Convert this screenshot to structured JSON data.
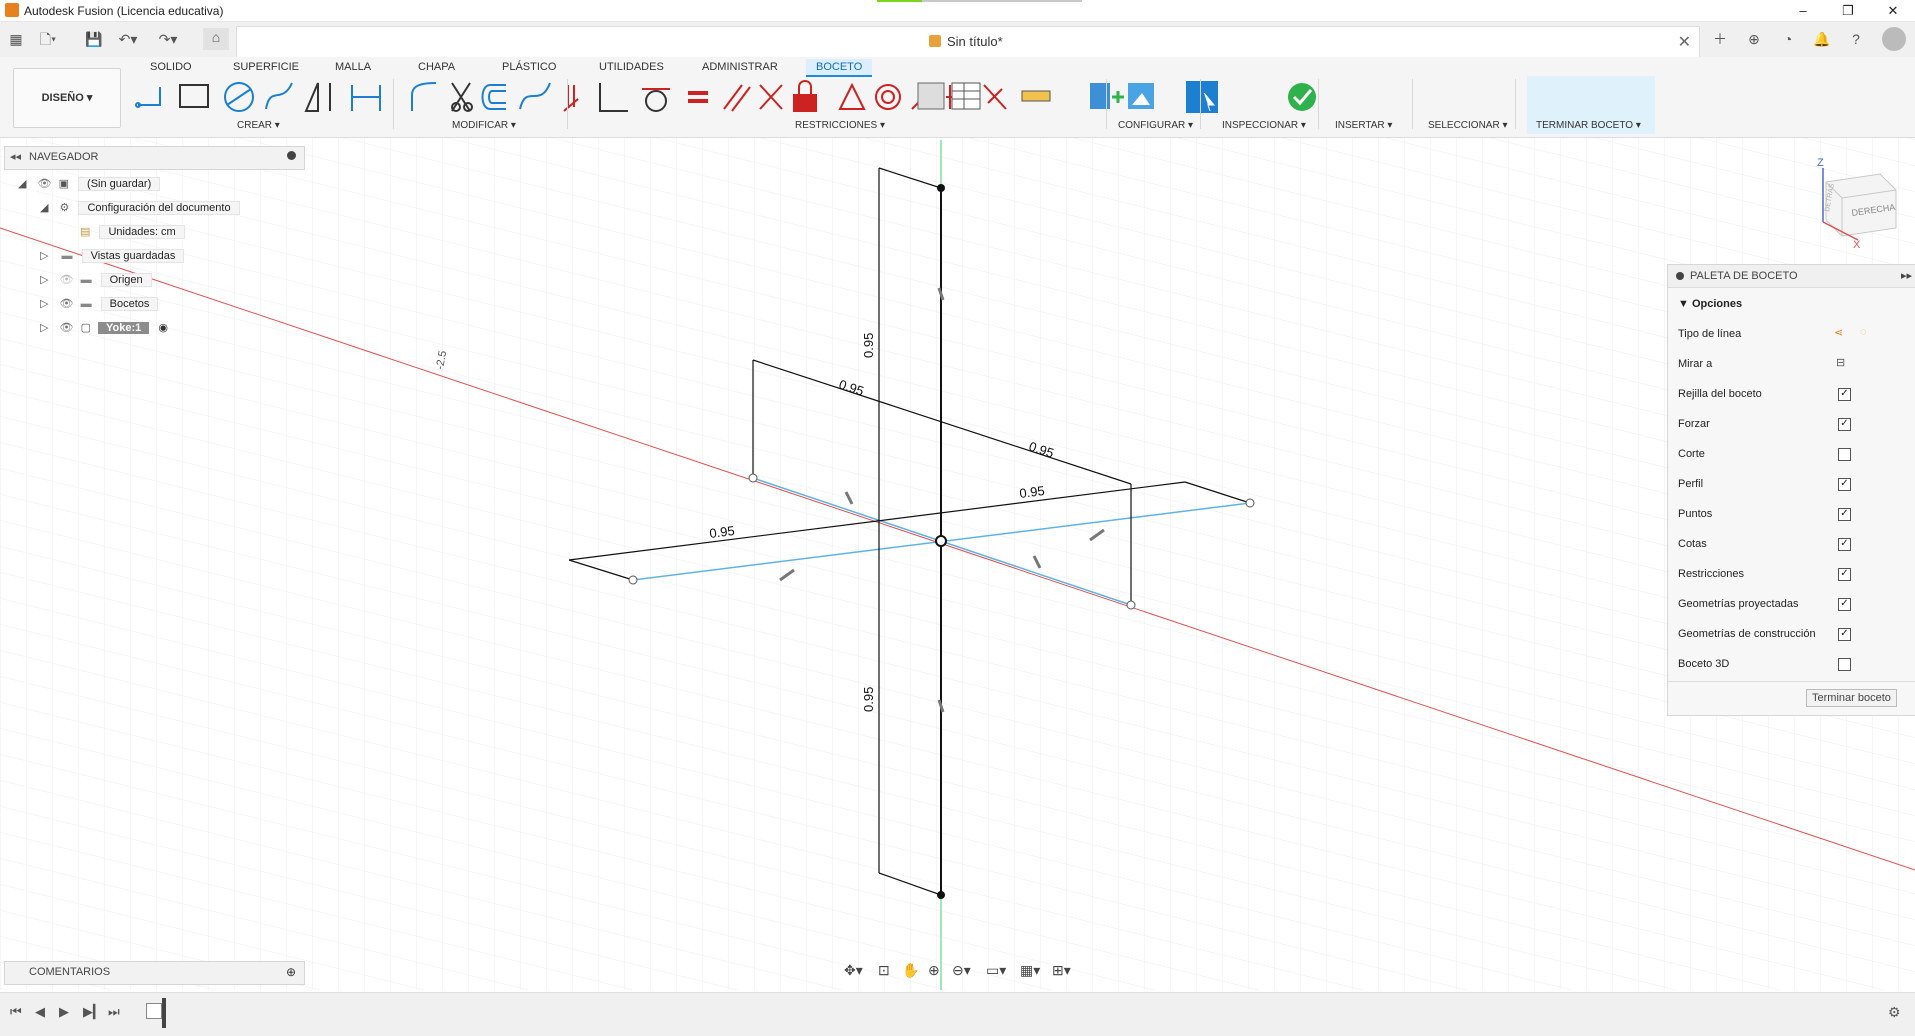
{
  "window": {
    "title": "Autodesk Fusion (Licencia educativa)",
    "document_title": "Sin título*",
    "minimize": "–",
    "restore": "❐",
    "close": "✕"
  },
  "ribbon": {
    "tabs": [
      {
        "label": "SOLIDO"
      },
      {
        "label": "SUPERFICIE"
      },
      {
        "label": "MALLA"
      },
      {
        "label": "CHAPA"
      },
      {
        "label": "PLÁSTICO"
      },
      {
        "label": "UTILIDADES"
      },
      {
        "label": "ADMINISTRAR"
      },
      {
        "label": "BOCETO"
      }
    ],
    "active_tab": "BOCETO",
    "workspace_button": "DISEÑO ▾",
    "groups": {
      "crear": "CREAR ▾",
      "modificar": "MODIFICAR ▾",
      "restricciones": "RESTRICCIONES ▾",
      "configurar": "CONFIGURAR ▾",
      "inspeccionar": "INSPECCIONAR ▾",
      "insertar": "INSERTAR ▾",
      "seleccionar": "SELECCIONAR ▾",
      "terminar": "TERMINAR BOCETO ▾"
    }
  },
  "navigator": {
    "title": "NAVEGADOR",
    "items": [
      {
        "label": "(Sin guardar)"
      },
      {
        "label": "Configuración del documento"
      },
      {
        "label": "Unidades: cm"
      },
      {
        "label": "Vistas guardadas"
      },
      {
        "label": "Origen"
      },
      {
        "label": "Bocetos"
      },
      {
        "label": "Yoke:1"
      }
    ]
  },
  "viewcube": {
    "face": "DERECHA",
    "side": "DETRÁS",
    "z": "Z",
    "x": "X"
  },
  "sketch": {
    "dimensions": [
      "0.95",
      "0.95",
      "0.95",
      "0.95",
      "0.95",
      "0.95"
    ],
    "axis_label": "-2.5"
  },
  "palette": {
    "title": "PALETA DE BOCETO",
    "section": "Opciones",
    "rows": [
      {
        "label": "Tipo de línea",
        "control": "icons"
      },
      {
        "label": "Mirar a",
        "control": "icon"
      },
      {
        "label": "Rejilla del boceto",
        "checked": true
      },
      {
        "label": "Forzar",
        "checked": true
      },
      {
        "label": "Corte",
        "checked": false
      },
      {
        "label": "Perfil",
        "checked": true
      },
      {
        "label": "Puntos",
        "checked": true
      },
      {
        "label": "Cotas",
        "checked": true
      },
      {
        "label": "Restricciones",
        "checked": true
      },
      {
        "label": "Geometrías proyectadas",
        "checked": true
      },
      {
        "label": "Geometrías de construcción",
        "checked": true
      },
      {
        "label": "Boceto 3D",
        "checked": false
      }
    ],
    "finish_button": "Terminar boceto"
  },
  "comments": {
    "title": "COMENTARIOS"
  },
  "colors": {
    "accent": "#1c8cde",
    "sketch_line": "#111111",
    "construction_line": "#5fb3e0",
    "axis_red": "#e05050",
    "axis_green": "#3fd07a",
    "finish_check": "#2fb24c"
  }
}
